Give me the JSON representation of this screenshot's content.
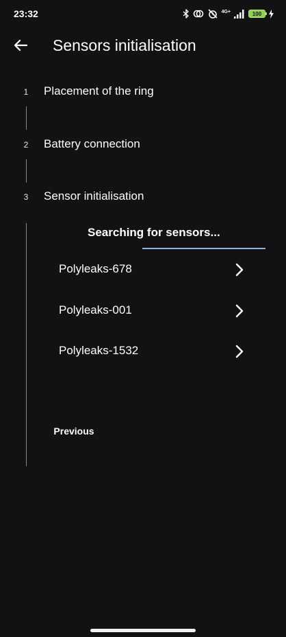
{
  "status_bar": {
    "time": "23:32",
    "network": "4G+",
    "battery": "100",
    "icons": [
      "bluetooth-icon",
      "hotspot-icon",
      "alarm-off-icon",
      "signal-icon",
      "battery-icon",
      "charging-icon"
    ]
  },
  "app_bar": {
    "title": "Sensors initialisation",
    "back_icon": "arrow-back-icon"
  },
  "stepper": {
    "steps": [
      {
        "number": "1",
        "title": "Placement of the ring"
      },
      {
        "number": "2",
        "title": "Battery connection"
      },
      {
        "number": "3",
        "title": "Sensor initialisation"
      }
    ],
    "active_step": 3
  },
  "sensor_step": {
    "searching_text": "Searching for sensors...",
    "progress_color": "#8bb4e8",
    "sensors": [
      {
        "label": "Polyleaks-678"
      },
      {
        "label": "Polyleaks-001"
      },
      {
        "label": "Polyleaks-1532"
      }
    ],
    "previous_label": "Previous"
  },
  "colors": {
    "background": "#121212",
    "text": "#ffffff",
    "step_line": "#8a8a8a",
    "battery": "#8fd14f"
  }
}
